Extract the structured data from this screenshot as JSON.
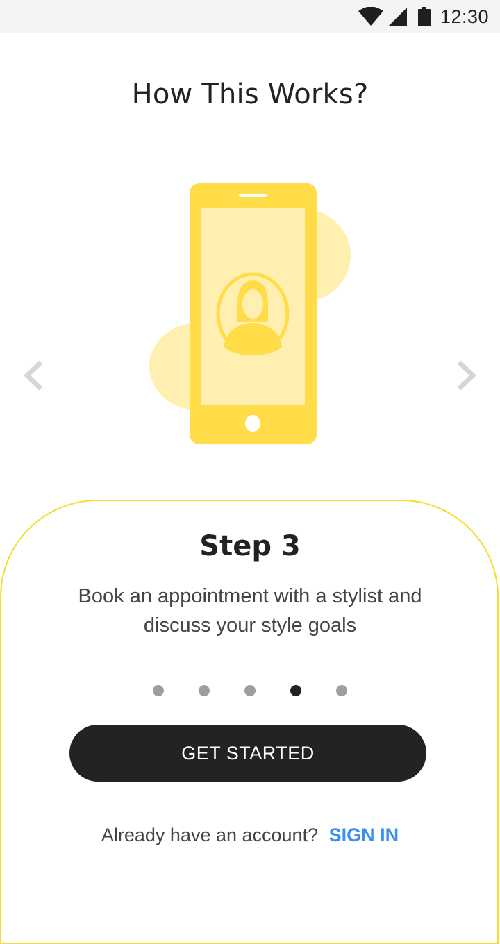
{
  "status_bar": {
    "time": "12:30",
    "icons": [
      "wifi-icon",
      "cellular-signal-icon",
      "battery-icon"
    ]
  },
  "header": {
    "title": "How This Works?"
  },
  "carousel": {
    "illustration": "phone-profile-illustration",
    "prev_icon": "chevron-left-icon",
    "next_icon": "chevron-right-icon",
    "step_title": "Step 3",
    "step_description": "Book an appointment with a stylist and discuss your style goals",
    "total_steps": 5,
    "active_step": 4
  },
  "actions": {
    "get_started_label": "GET STARTED",
    "account_prompt": "Already have an account?",
    "sign_in_label": "SIGN IN"
  },
  "colors": {
    "accent_yellow": "#FFDC48",
    "light_yellow": "#FFEFB1",
    "card_border": "#F7DC2E",
    "button_dark": "#232323",
    "link_blue": "#3D8FF0",
    "dot_inactive": "#9E9E9E",
    "dot_active": "#222222"
  }
}
